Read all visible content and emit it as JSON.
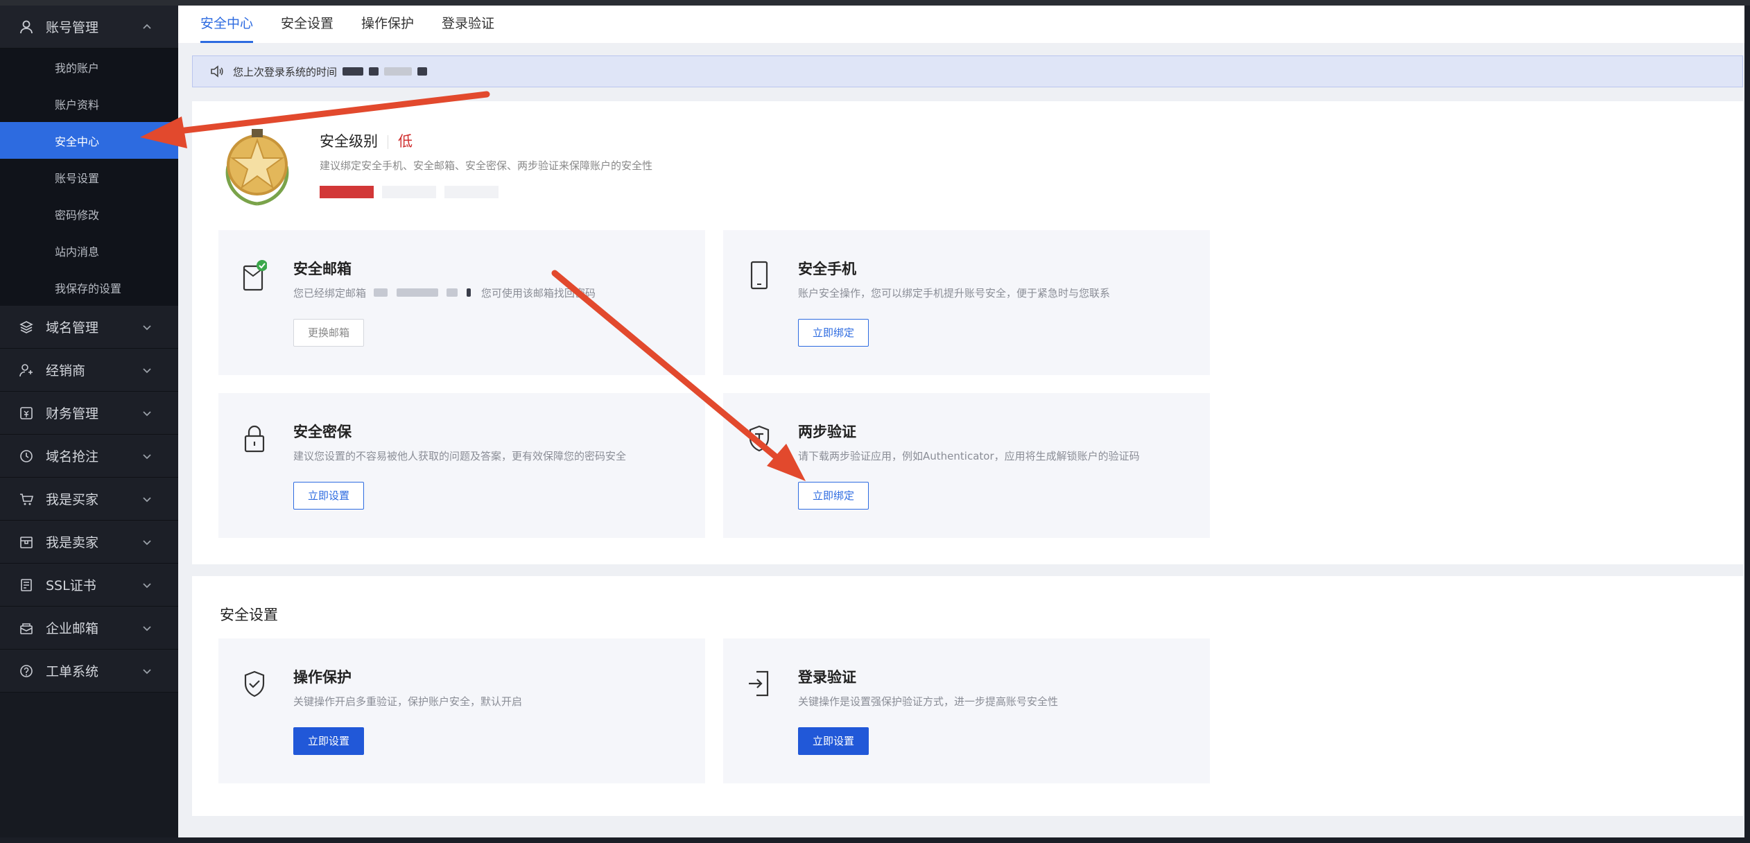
{
  "sidebar": {
    "account_group": "账号管理",
    "sub_items": [
      "我的账户",
      "账户资料",
      "安全中心",
      "账号设置",
      "密码修改",
      "站内消息",
      "我保存的设置"
    ],
    "groups": [
      "域名管理",
      "经销商",
      "财务管理",
      "域名抢注",
      "我是买家",
      "我是卖家",
      "SSL证书",
      "企业邮箱",
      "工单系统"
    ]
  },
  "tabs": [
    "安全中心",
    "安全设置",
    "操作保护",
    "登录验证"
  ],
  "notice": {
    "text": "您上次登录系统的时间"
  },
  "level": {
    "label": "安全级别",
    "value": "低",
    "desc": "建议绑定安全手机、安全邮箱、安全密保、两步验证来保障账户的安全性"
  },
  "cards": {
    "email": {
      "title": "安全邮箱",
      "desc_prefix": "您已经绑定邮箱",
      "desc_suffix": "您可使用该邮箱找回密码",
      "button": "更换邮箱"
    },
    "phone": {
      "title": "安全手机",
      "desc": "账户安全操作，您可以绑定手机提升账号安全，便于紧急时与您联系",
      "button": "立即绑定"
    },
    "question": {
      "title": "安全密保",
      "desc": "建议您设置的不容易被他人获取的问题及答案，更有效保障您的密码安全",
      "button": "立即设置"
    },
    "twostep": {
      "title": "两步验证",
      "desc": "请下载两步验证应用，例如Authenticator，应用将生成解锁账户的验证码",
      "button": "立即绑定"
    }
  },
  "settings": {
    "title": "安全设置",
    "protect": {
      "title": "操作保护",
      "desc": "关键操作开启多重验证，保护账户安全，默认开启",
      "button": "立即设置"
    },
    "login": {
      "title": "登录验证",
      "desc": "关键操作是设置强保护验证方式，进一步提高账号安全性",
      "button": "立即设置"
    }
  },
  "colors": {
    "accent": "#2d6be0",
    "danger": "#d02f2f",
    "annotation": "#e2492d"
  },
  "icons": [
    "user-icon",
    "layers-icon",
    "dealer-icon",
    "finance-icon",
    "clock-icon",
    "cart-icon",
    "store-icon",
    "ssl-icon",
    "mail-box-icon",
    "help-icon",
    "speaker-icon",
    "email-icon",
    "phone-icon",
    "lock-icon",
    "shield-t-icon",
    "shield-check-icon",
    "login-icon",
    "medal-icon"
  ]
}
